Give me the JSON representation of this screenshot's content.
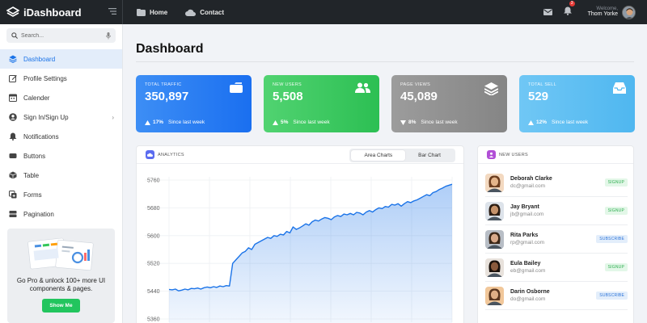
{
  "brand": {
    "name": "iDashboard"
  },
  "topnav": {
    "home": "Home",
    "contact": "Contact"
  },
  "notifications": {
    "count": "3"
  },
  "user": {
    "welcome": "Welcome,",
    "name": "Thom Yorke"
  },
  "search": {
    "placeholder": "Search..."
  },
  "sidebar": {
    "items": [
      {
        "label": "Dashboard",
        "icon": "layers-icon",
        "active": true
      },
      {
        "label": "Profile Settings",
        "icon": "edit-icon"
      },
      {
        "label": "Calender",
        "icon": "calendar-icon"
      },
      {
        "label": "Sign In/Sign Up",
        "icon": "user-icon"
      },
      {
        "label": "Notifications",
        "icon": "bell-icon"
      },
      {
        "label": "Buttons",
        "icon": "buttons-icon"
      },
      {
        "label": "Table",
        "icon": "cube-icon"
      },
      {
        "label": "Forms",
        "icon": "forms-icon"
      },
      {
        "label": "Pagination",
        "icon": "pagination-icon"
      }
    ],
    "promo_text": "Go Pro & unlock 100+ more UI components & pages.",
    "promo_button": "Show Me"
  },
  "page": {
    "title": "Dashboard"
  },
  "stats": [
    {
      "label": "TOTAL TRAFFIC",
      "value": "350,897",
      "change": "17%",
      "since": "Since last week",
      "color": "#1a6ff0"
    },
    {
      "label": "NEW USERS",
      "value": "5,508",
      "change": "5%",
      "since": "Since last week",
      "color": "#2cbf53"
    },
    {
      "label": "PAGE VIEWS",
      "value": "45,089",
      "change": "8%",
      "since": "Since last week",
      "color": "#858585"
    },
    {
      "label": "TOTAL SELL",
      "value": "529",
      "change": "12%",
      "since": "Since last week",
      "color": "#4fb7f0"
    }
  ],
  "analytics": {
    "title": "ANALYTICS",
    "tabs": [
      "Area Charts",
      "Bar Chart"
    ],
    "active_tab": "Area Charts"
  },
  "chart_data": {
    "type": "area",
    "title": "",
    "yticks": [
      5760,
      5680,
      5600,
      5520,
      5440,
      5360
    ],
    "ylim": [
      5360,
      5760
    ],
    "color": "#1a73e8",
    "values": [
      5445,
      5444,
      5446,
      5441,
      5443,
      5446,
      5444,
      5448,
      5447,
      5449,
      5446,
      5450,
      5452,
      5450,
      5453,
      5451,
      5455,
      5453,
      5456,
      5455,
      5520,
      5530,
      5540,
      5550,
      5555,
      5565,
      5560,
      5575,
      5580,
      5585,
      5590,
      5595,
      5592,
      5600,
      5598,
      5604,
      5602,
      5612,
      5608,
      5625,
      5618,
      5622,
      5628,
      5634,
      5630,
      5640,
      5645,
      5642,
      5648,
      5652,
      5650,
      5646,
      5654,
      5658,
      5655,
      5662,
      5660,
      5664,
      5660,
      5667,
      5665,
      5660,
      5668,
      5672,
      5668,
      5675,
      5680,
      5678,
      5684,
      5682,
      5690,
      5688,
      5692,
      5685,
      5692,
      5698,
      5695,
      5700,
      5703,
      5708,
      5713,
      5718,
      5715,
      5724,
      5727,
      5733,
      5737,
      5742,
      5745,
      5748
    ]
  },
  "new_users": {
    "title": "NEW USERS",
    "list": [
      {
        "name": "Deborah Clarke",
        "email": "dc@gmail.com",
        "badge": "SIGNUP",
        "type": "signup",
        "skin": "#e3b48a",
        "hair": "#6b3d1f",
        "bg": "#f3d9c0"
      },
      {
        "name": "Jay Bryant",
        "email": "jb@gmail.com",
        "badge": "SIGNUP",
        "type": "signup",
        "skin": "#c6936b",
        "hair": "#2b1c12",
        "bg": "#dde3ea"
      },
      {
        "name": "Rita Parks",
        "email": "rp@gmail.com",
        "badge": "SUBSCRIBE",
        "type": "subscribe",
        "skin": "#d7a98a",
        "hair": "#3a2718",
        "bg": "#b8bec6"
      },
      {
        "name": "Eula Bailey",
        "email": "eb@gmail.com",
        "badge": "SIGNUP",
        "type": "signup",
        "skin": "#8a5a3c",
        "hair": "#1a110b",
        "bg": "#e8e2dc"
      },
      {
        "name": "Darin Osborne",
        "email": "do@gmail.com",
        "badge": "SUBSCRIBE",
        "type": "subscribe",
        "skin": "#e0ae86",
        "hair": "#5a3620",
        "bg": "#f1c79a"
      }
    ]
  }
}
